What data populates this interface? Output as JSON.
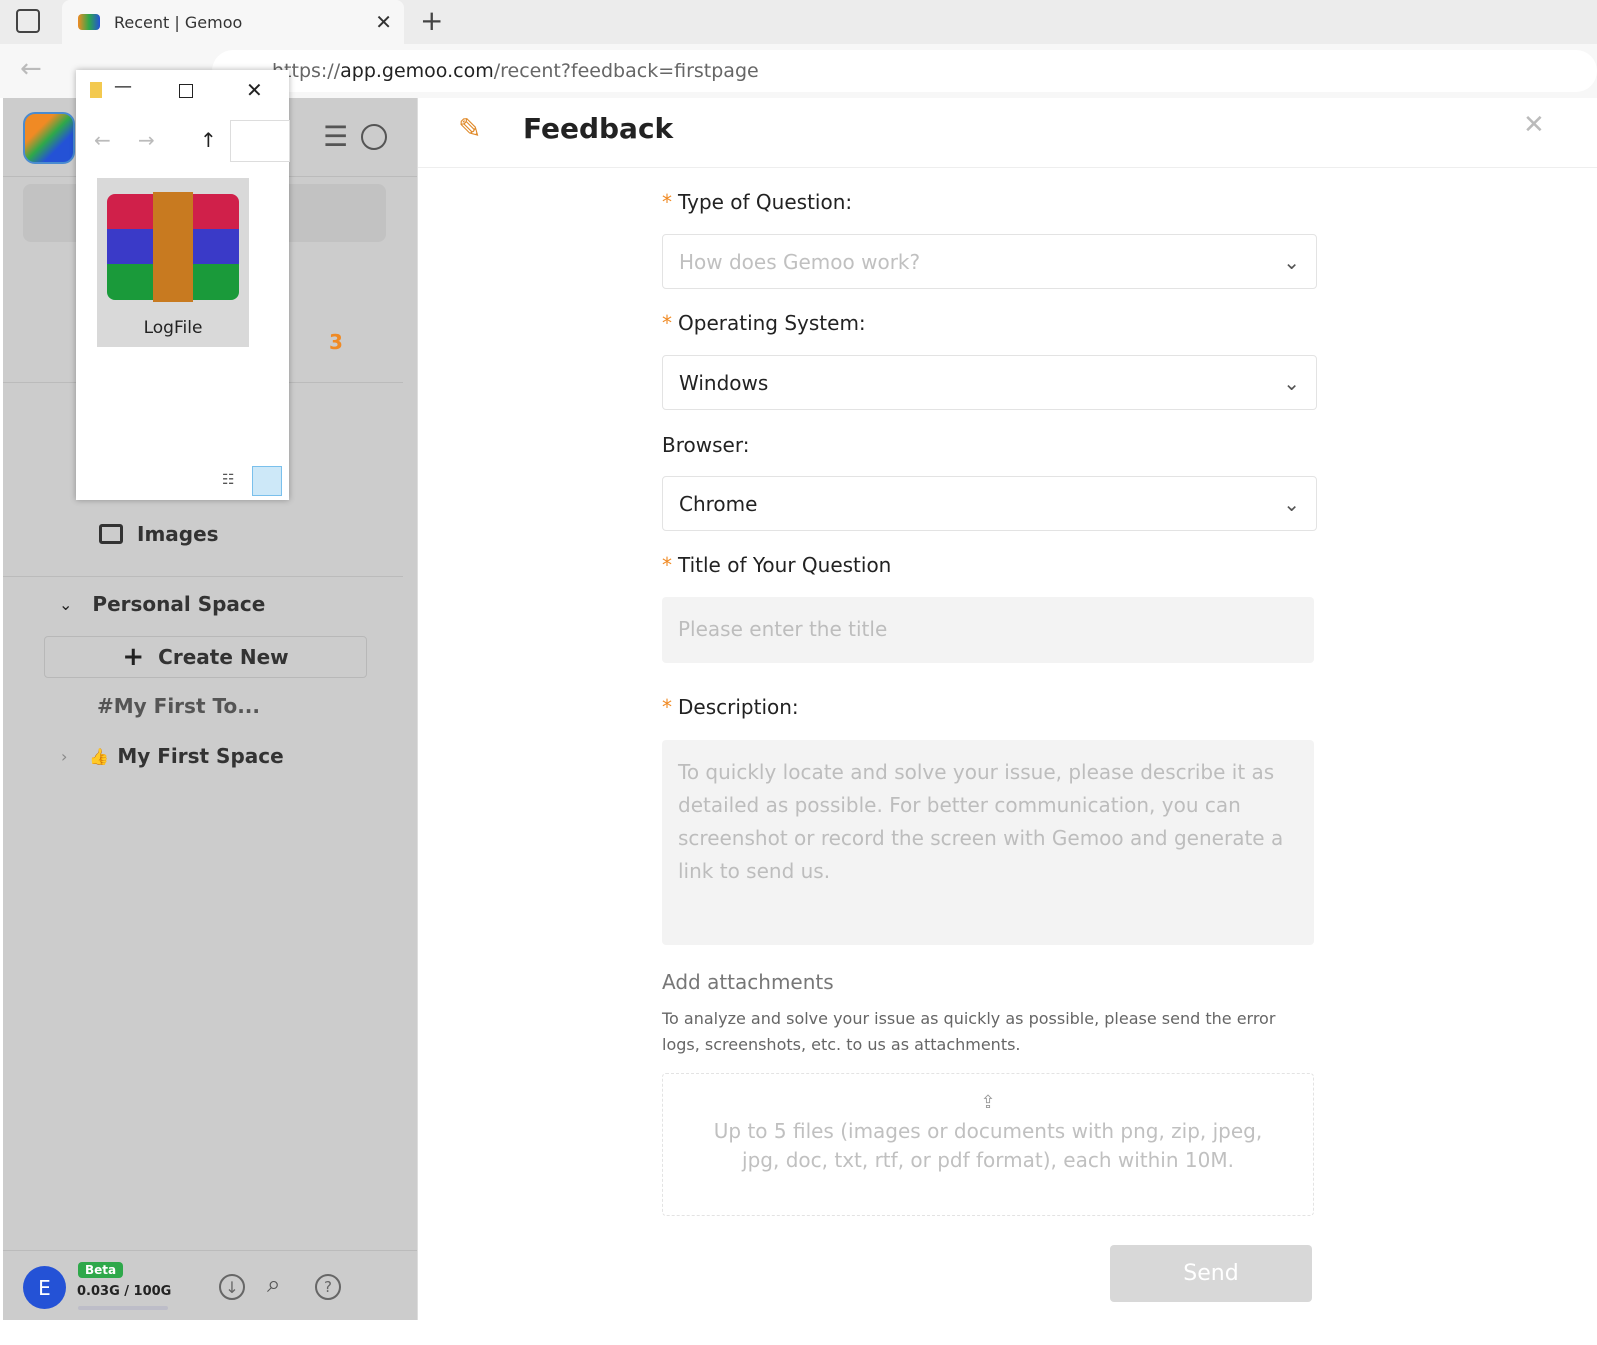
{
  "browser": {
    "tab_title": "Recent | Gemoo",
    "url_prefix": "https://",
    "url_host": "app.gemoo.com",
    "url_path": "/recent?feedback=firstpage"
  },
  "sidebar": {
    "notification_count": "3",
    "images_label": "Images",
    "personal_space": "Personal Space",
    "create_new": "Create New",
    "items": [
      "#My First To...",
      "My First Space"
    ],
    "user_initial": "E",
    "beta": "Beta",
    "storage": "0.03G / 100G",
    "storage_fraction": 0.0003
  },
  "explorer": {
    "file_name": "LogFile"
  },
  "feedback": {
    "title": "Feedback",
    "type_label": "Type of Question:",
    "type_placeholder": "How does Gemoo work?",
    "os_label": "Operating System:",
    "os_value": "Windows",
    "browser_label": "Browser:",
    "browser_value": "Chrome",
    "title_label": "Title of Your Question",
    "title_placeholder": "Please enter the title",
    "desc_label": "Description:",
    "desc_placeholder": "To quickly locate and solve your issue, please describe it as detailed as possible. For better communication, you can screenshot or record the screen with Gemoo and generate a link to send us.",
    "attach_label": "Add attachments",
    "attach_help": "To analyze and solve your issue as quickly as possible, please send the error logs, screenshots, etc. to us as attachments.",
    "upload_text": "Up to 5 files (images or documents with png, zip, jpeg, jpg, doc, txt, rtf, or pdf format), each within 10M.",
    "send": "Send"
  },
  "colors": {
    "accent": "#f08a24",
    "beta": "#2ea84a",
    "avatar": "#2452d6"
  }
}
